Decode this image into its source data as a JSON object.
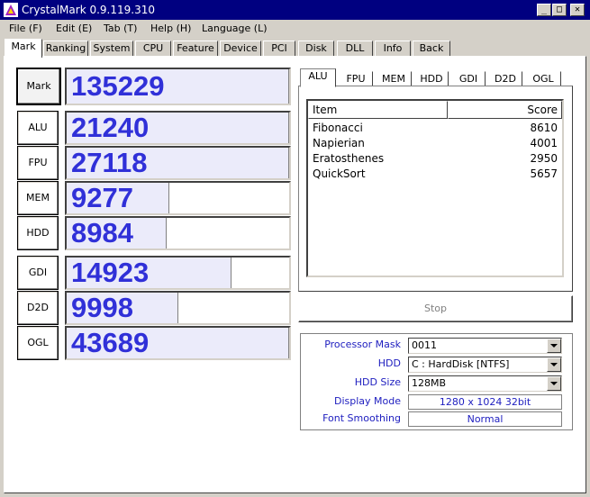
{
  "window": {
    "title": "CrystalMark 0.9.119.310",
    "controls": {
      "minimize": "_",
      "maximize": "□",
      "close": "✕"
    }
  },
  "menu": [
    {
      "label": "File (F)"
    },
    {
      "label": "Edit (E)"
    },
    {
      "label": "Tab (T)"
    },
    {
      "label": "Help (H)"
    },
    {
      "label": "Language (L)"
    }
  ],
  "main_tabs": [
    {
      "label": "Mark",
      "active": true
    },
    {
      "label": "Ranking"
    },
    {
      "label": "System"
    },
    {
      "label": "CPU"
    },
    {
      "label": "Feature"
    },
    {
      "label": "Device"
    },
    {
      "label": "PCI"
    },
    {
      "label": "Disk"
    },
    {
      "label": "DLL"
    },
    {
      "label": "Info"
    },
    {
      "label": "Back"
    }
  ],
  "scores": {
    "mark": {
      "label": "Mark",
      "value": "135229",
      "fill": 1.0
    },
    "alu": {
      "label": "ALU",
      "value": "21240",
      "fill": 1.0
    },
    "fpu": {
      "label": "FPU",
      "value": "27118",
      "fill": 1.0
    },
    "mem": {
      "label": "MEM",
      "value": "9277",
      "fill": 0.46
    },
    "hdd": {
      "label": "HDD",
      "value": "8984",
      "fill": 0.45
    },
    "gdi": {
      "label": "GDI",
      "value": "14923",
      "fill": 0.74
    },
    "d2d": {
      "label": "D2D",
      "value": "9998",
      "fill": 0.5
    },
    "ogl": {
      "label": "OGL",
      "value": "43689",
      "fill": 1.0
    }
  },
  "sub_tabs": [
    {
      "label": "ALU",
      "active": true
    },
    {
      "label": "FPU"
    },
    {
      "label": "MEM"
    },
    {
      "label": "HDD"
    },
    {
      "label": "GDI"
    },
    {
      "label": "D2D"
    },
    {
      "label": "OGL"
    }
  ],
  "list": {
    "headers": {
      "item": "Item",
      "score": "Score"
    },
    "rows": [
      {
        "item": "Fibonacci",
        "score": "8610"
      },
      {
        "item": "Napierian",
        "score": "4001"
      },
      {
        "item": "Eratosthenes",
        "score": "2950"
      },
      {
        "item": "QuickSort",
        "score": "5657"
      }
    ]
  },
  "stop_label": "Stop",
  "settings": {
    "processor_mask": {
      "label": "Processor Mask",
      "value": "0011"
    },
    "hdd": {
      "label": "HDD",
      "value": "C : HardDisk [NTFS]"
    },
    "hdd_size": {
      "label": "HDD Size",
      "value": "128MB"
    },
    "display_mode": {
      "label": "Display Mode",
      "value": "1280 x 1024 32bit"
    },
    "font_smoothing": {
      "label": "Font Smoothing",
      "value": "Normal"
    }
  }
}
